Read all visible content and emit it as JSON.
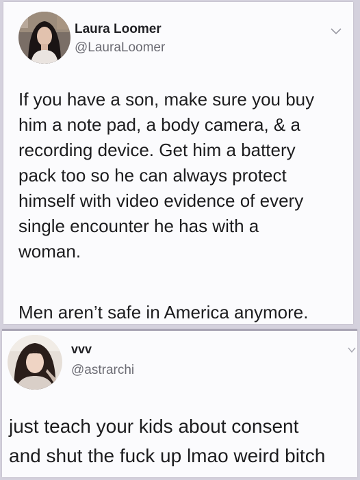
{
  "tweets": [
    {
      "display_name": "Laura Loomer",
      "handle": "@LauraLoomer",
      "avatar_icon": "profile-photo",
      "menu_icon": "chevron-down-icon",
      "paragraphs": [
        {
          "lines": [
            "If you have a son, make sure you buy",
            "him a note pad, a body camera, & a",
            "recording device. Get him a battery",
            "pack too so he can always protect",
            "himself with video evidence of every",
            "single encounter he has with a",
            "woman."
          ]
        },
        {
          "lines": [
            "Men aren’t safe in America anymore."
          ]
        }
      ]
    },
    {
      "display_name": "vvv",
      "handle": "@astrarchi",
      "avatar_icon": "profile-photo",
      "menu_icon": "chevron-down-icon",
      "paragraphs": [
        {
          "lines": [
            "just teach your kids about consent",
            "and shut the fuck up lmao weird bitch"
          ]
        }
      ]
    }
  ],
  "colors": {
    "background": "#d4d1dd",
    "card": "#fbfbfd",
    "text": "#1c1c1e",
    "handle": "#6b6b73"
  }
}
